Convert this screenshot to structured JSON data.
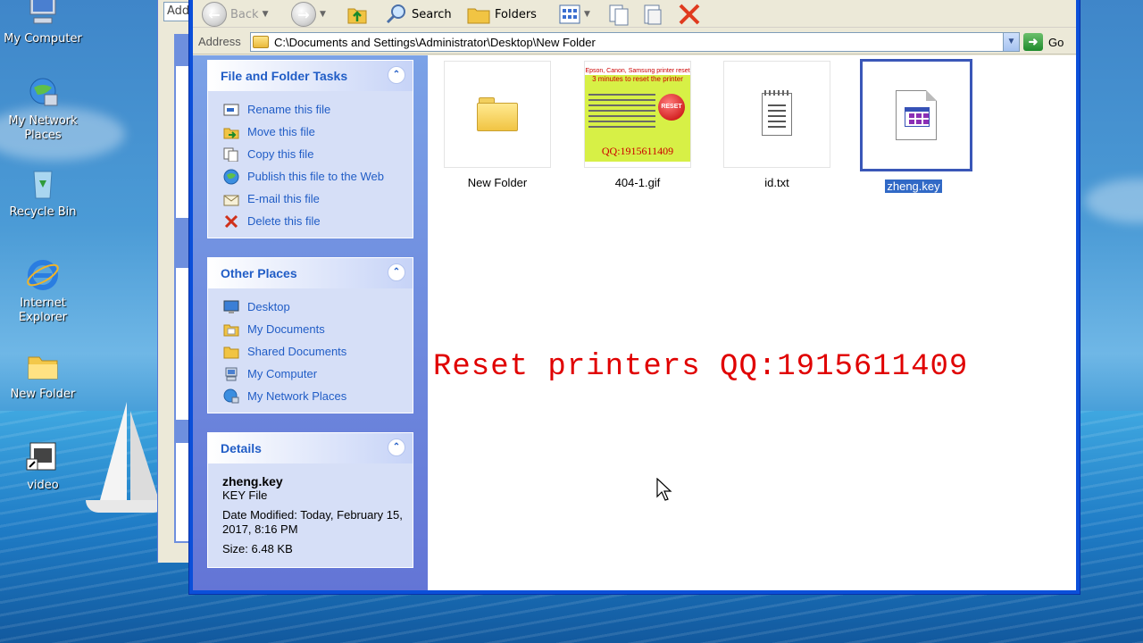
{
  "desktop": {
    "icons": [
      {
        "label": "My Computer"
      },
      {
        "label": "My Network Places"
      },
      {
        "label": "Recycle Bin"
      },
      {
        "label": "Internet Explorer"
      },
      {
        "label": "New Folder"
      },
      {
        "label": "video"
      }
    ]
  },
  "background_window": {
    "address_fragment": "Add"
  },
  "toolbar": {
    "back_label": "Back",
    "search_label": "Search",
    "folders_label": "Folders"
  },
  "addressbar": {
    "label": "Address",
    "path": "C:\\Documents and Settings\\Administrator\\Desktop\\New Folder",
    "go_label": "Go"
  },
  "taskpane": {
    "file_tasks": {
      "title": "File and Folder Tasks",
      "items": [
        {
          "label": "Rename this file",
          "icon": "rename-icon"
        },
        {
          "label": "Move this file",
          "icon": "move-icon"
        },
        {
          "label": "Copy this file",
          "icon": "copy-icon"
        },
        {
          "label": "Publish this file to the Web",
          "icon": "globe-icon"
        },
        {
          "label": "E-mail this file",
          "icon": "email-icon"
        },
        {
          "label": "Delete this file",
          "icon": "delete-icon"
        }
      ]
    },
    "other_places": {
      "title": "Other Places",
      "items": [
        {
          "label": "Desktop",
          "icon": "desktop-icon"
        },
        {
          "label": "My Documents",
          "icon": "my-documents-icon"
        },
        {
          "label": "Shared Documents",
          "icon": "shared-folder-icon"
        },
        {
          "label": "My Computer",
          "icon": "computer-icon"
        },
        {
          "label": "My Network Places",
          "icon": "network-icon"
        }
      ]
    },
    "details": {
      "title": "Details",
      "name": "zheng.key",
      "type": "KEY File",
      "modified": "Date Modified: Today, February 15, 2017, 8:16 PM",
      "size": "Size: 6.48 KB"
    }
  },
  "files": [
    {
      "name": "New Folder",
      "kind": "folder",
      "selected": false
    },
    {
      "name": "404-1.gif",
      "kind": "image",
      "selected": false
    },
    {
      "name": "id.txt",
      "kind": "text",
      "selected": false
    },
    {
      "name": "zheng.key",
      "kind": "key",
      "selected": true
    }
  ],
  "gif_thumbnail": {
    "line1": "Epson, Canon, Samsung printer reset",
    "line2": "3 minutes to reset the printer",
    "button": "RESET",
    "qq": "QQ:1915611409"
  },
  "overlay_text": "Reset printers QQ:1915611409",
  "colors": {
    "link": "#215dc6",
    "selection": "#3169c6",
    "overlay": "#e00000"
  }
}
